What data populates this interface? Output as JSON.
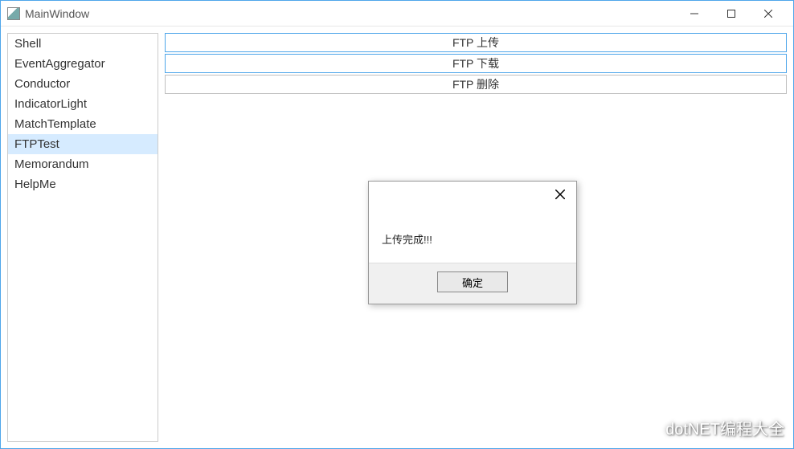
{
  "window": {
    "title": "MainWindow"
  },
  "sidebar": {
    "items": [
      {
        "label": "Shell",
        "selected": false
      },
      {
        "label": "EventAggregator",
        "selected": false
      },
      {
        "label": "Conductor",
        "selected": false
      },
      {
        "label": "IndicatorLight",
        "selected": false
      },
      {
        "label": "MatchTemplate",
        "selected": false
      },
      {
        "label": "FTPTest",
        "selected": true
      },
      {
        "label": "Memorandum",
        "selected": false
      },
      {
        "label": "HelpMe",
        "selected": false
      }
    ]
  },
  "main": {
    "actions": [
      {
        "label": "FTP 上传",
        "style": "primary"
      },
      {
        "label": "FTP 下载",
        "style": "primary"
      },
      {
        "label": "FTP 删除",
        "style": "alt"
      }
    ]
  },
  "dialog": {
    "message": "上传完成!!!",
    "ok_label": "确定"
  },
  "watermark": {
    "text": "dotNET编程大全"
  }
}
